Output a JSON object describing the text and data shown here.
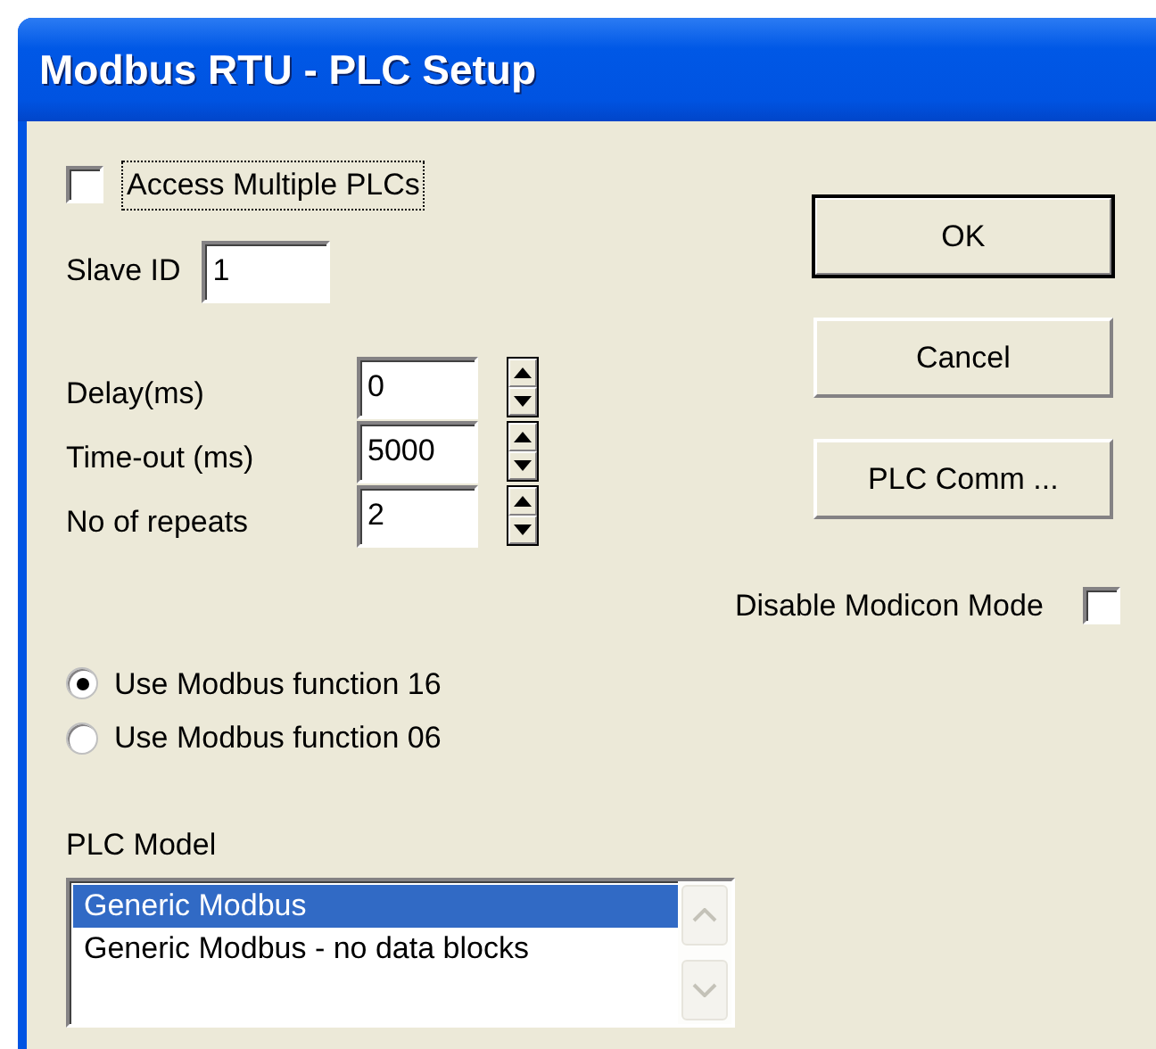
{
  "window": {
    "title": "Modbus RTU - PLC Setup"
  },
  "access_multiple": {
    "label": "Access Multiple PLCs",
    "checked": false,
    "focused": true
  },
  "slave_id": {
    "label": "Slave ID",
    "value": "1"
  },
  "spinners": [
    {
      "label": "Delay(ms)",
      "value": "0"
    },
    {
      "label": "Time-out (ms)",
      "value": "5000"
    },
    {
      "label": "No of repeats",
      "value": "2"
    }
  ],
  "function_options": [
    {
      "label": "Use Modbus function 16",
      "selected": true
    },
    {
      "label": "Use Modbus function 06",
      "selected": false
    }
  ],
  "plc_model": {
    "label": "PLC Model",
    "items": [
      {
        "label": "Generic Modbus",
        "selected": true
      },
      {
        "label": "Generic Modbus - no data blocks",
        "selected": false
      }
    ]
  },
  "buttons": [
    {
      "label": "OK",
      "default": true
    },
    {
      "label": "Cancel",
      "default": false
    },
    {
      "label": "PLC Comm ...",
      "default": false
    }
  ],
  "disable_modicon": {
    "label": "Disable Modicon Mode",
    "checked": false
  }
}
